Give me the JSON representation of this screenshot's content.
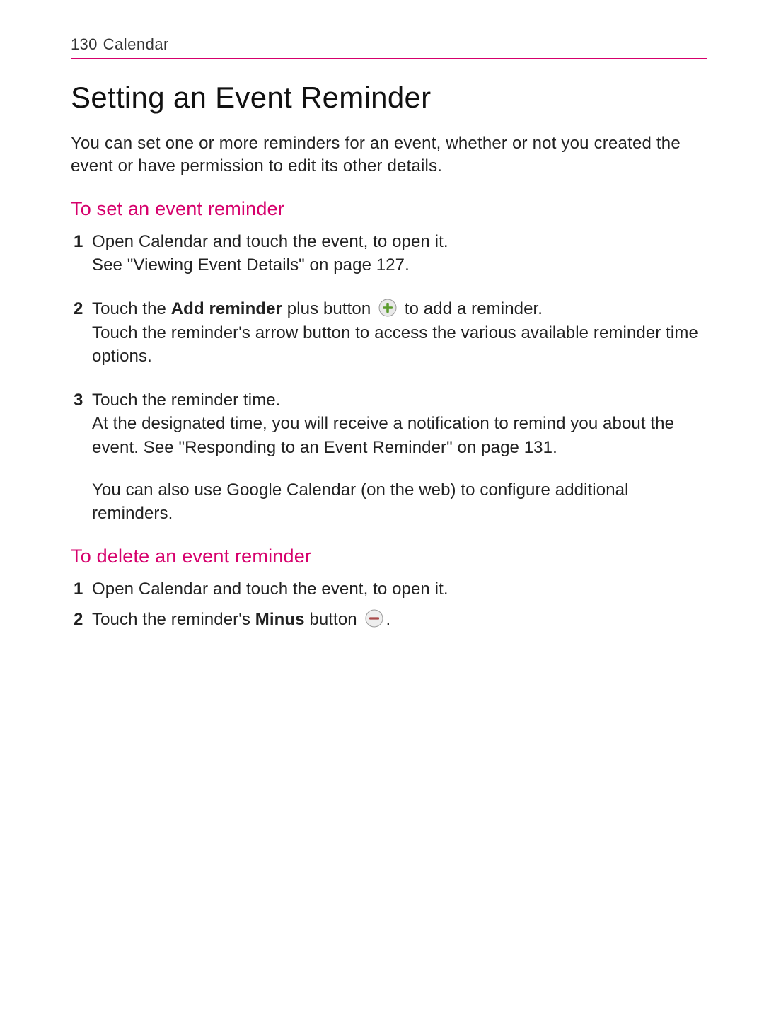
{
  "header": {
    "page_number": "130",
    "section": "Calendar"
  },
  "title": "Setting an Event Reminder",
  "intro": "You can set one or more reminders for an event, whether or not you created the event or have permission to edit its other details.",
  "section_set": {
    "heading": "To set an event reminder",
    "steps": {
      "s1_num": "1",
      "s1_a": "Open Calendar and touch the event, to open it.",
      "s1_b": "See \"Viewing Event Details\" on page 127.",
      "s2_num": "2",
      "s2_a_pre": "Touch the ",
      "s2_a_bold": "Add reminder",
      "s2_a_mid": " plus button ",
      "s2_a_post": " to add a reminder.",
      "s2_b": "Touch the reminder's arrow button to access the various available reminder time options.",
      "s3_num": "3",
      "s3_a": "Touch the reminder time.",
      "s3_b": "At the designated time, you will receive a notification to remind you about the event. See \"Responding to an Event Reminder\" on page 131.",
      "s3_c": "You can also use Google Calendar (on the web) to configure additional reminders."
    }
  },
  "section_delete": {
    "heading": "To delete an event reminder",
    "steps": {
      "s1_num": "1",
      "s1_a": "Open Calendar and touch the event, to open it.",
      "s2_num": "2",
      "s2_a_pre": "Touch the reminder's ",
      "s2_a_bold": "Minus",
      "s2_a_mid": " button ",
      "s2_a_post": "."
    }
  },
  "colors": {
    "accent": "#d6006c",
    "plus_icon_fill": "#5b9b2e",
    "minus_icon_fill": "#a84a4a",
    "icon_ring": "#9a9a9a"
  }
}
